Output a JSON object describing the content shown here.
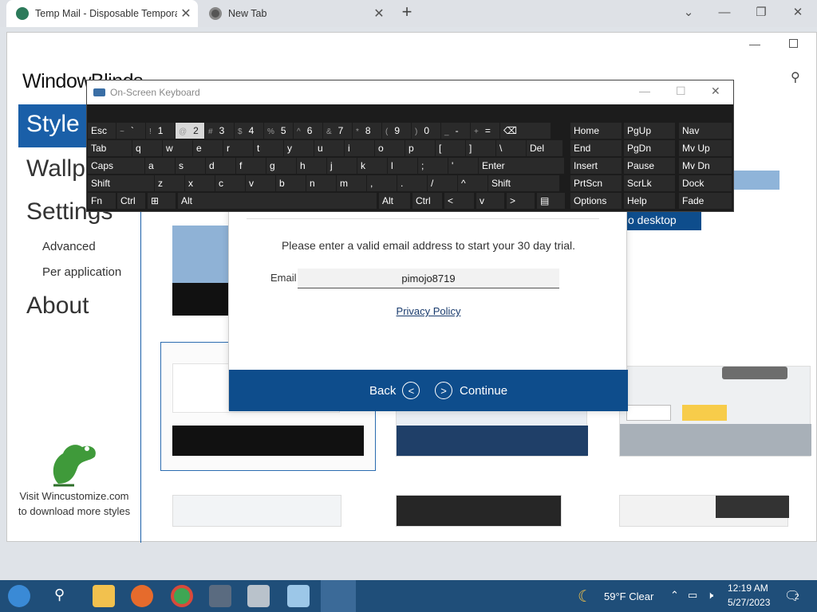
{
  "browser": {
    "tabs": [
      {
        "title": "Temp Mail - Disposable Tempora",
        "active": true
      },
      {
        "title": "New Tab",
        "active": false
      }
    ],
    "new_tab": "+",
    "controls": {
      "dropdown": "⌄",
      "minimize": "—",
      "maximize": "❐",
      "close": "✕"
    }
  },
  "app": {
    "title": "WindowBlinds",
    "nav": {
      "style": "Style",
      "wallpaper": "Wallpa",
      "settings": "Settings",
      "advanced": "Advanced",
      "per_application": "Per application",
      "about": "About"
    },
    "promo": "Visit Wincustomize.com to download more styles",
    "desktop_btn_partial": "o desktop"
  },
  "dialog": {
    "message": "Please enter a valid email address to start your 30 day trial.",
    "email_label": "Email",
    "email_value": "pimojo8719",
    "privacy": "Privacy Policy",
    "back": "Back",
    "continue": "Continue"
  },
  "osk": {
    "title": "On-Screen Keyboard",
    "row1": [
      {
        "label": "Esc"
      },
      {
        "sup": "~",
        "label": "`"
      },
      {
        "sup": "!",
        "label": "1"
      },
      {
        "sup": "@",
        "label": "2"
      },
      {
        "sup": "#",
        "label": "3"
      },
      {
        "sup": "$",
        "label": "4"
      },
      {
        "sup": "%",
        "label": "5"
      },
      {
        "sup": "^",
        "label": "6"
      },
      {
        "sup": "&",
        "label": "7"
      },
      {
        "sup": "*",
        "label": "8"
      },
      {
        "sup": "(",
        "label": "9"
      },
      {
        "sup": ")",
        "label": "0"
      },
      {
        "sup": "_",
        "label": "-"
      },
      {
        "sup": "+",
        "label": "="
      },
      {
        "label": "⌫"
      }
    ],
    "row2": [
      "Tab",
      "q",
      "w",
      "e",
      "r",
      "t",
      "y",
      "u",
      "i",
      "o",
      "p",
      "[",
      "]",
      "\\",
      "Del"
    ],
    "row3": [
      "Caps",
      "a",
      "s",
      "d",
      "f",
      "g",
      "h",
      "j",
      "k",
      "l",
      ";",
      "'",
      "Enter"
    ],
    "row4": [
      "Shift",
      "z",
      "x",
      "c",
      "v",
      "b",
      "n",
      "m",
      ",",
      ".",
      "/",
      "^",
      "Shift"
    ],
    "row5": [
      "Fn",
      "Ctrl",
      "⊞",
      "Alt",
      "Alt",
      "Ctrl",
      "<",
      "v",
      ">",
      "▤"
    ],
    "nav_col1": [
      "Home",
      "End",
      "Insert",
      "PrtScn",
      "Options"
    ],
    "nav_col2": [
      "PgUp",
      "PgDn",
      "Pause",
      "ScrLk",
      "Help"
    ],
    "nav_col3": [
      "Nav",
      "Mv Up",
      "Mv Dn",
      "Dock",
      "Fade"
    ]
  },
  "taskbar": {
    "weather": "59°F Clear",
    "time": "12:19 AM",
    "date": "5/27/2023",
    "notifications": "2"
  }
}
